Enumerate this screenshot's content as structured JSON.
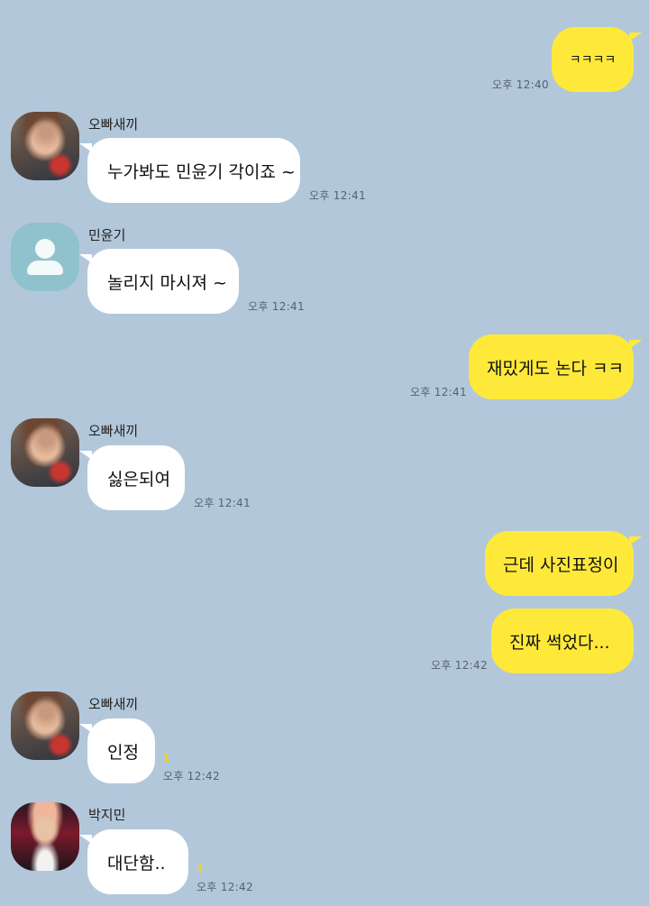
{
  "contacts": {
    "oppa": {
      "name": "오빠새끼",
      "avatar": "photo-avatar"
    },
    "yoongi": {
      "name": "민윤기",
      "avatar": "default-person-icon"
    },
    "jimin": {
      "name": "박지민",
      "avatar": "photo-avatar"
    }
  },
  "messages": [
    {
      "direction": "outgoing",
      "text": "ㅋㅋㅋㅋ",
      "time": "오후 12:40"
    },
    {
      "direction": "incoming",
      "sender": "오빠새끼",
      "text": "누가봐도 민윤기 각이죠 ~",
      "time": "오후 12:41"
    },
    {
      "direction": "incoming",
      "sender": "민윤기",
      "text": "놀리지 마시져 ~",
      "time": "오후 12:41"
    },
    {
      "direction": "outgoing",
      "text": "재밌게도 논다 ㅋㅋ",
      "time": "오후 12:41"
    },
    {
      "direction": "incoming",
      "sender": "오빠새끼",
      "text": "싫은되여",
      "time": "오후 12:41"
    },
    {
      "direction": "outgoing",
      "text": "근데 사진표정이",
      "time": ""
    },
    {
      "direction": "outgoing",
      "text": "진짜 썩었다...",
      "time": "오후 12:42"
    },
    {
      "direction": "incoming",
      "sender": "오빠새끼",
      "text": "인정",
      "time": "오후 12:42",
      "unread": "1"
    },
    {
      "direction": "incoming",
      "sender": "박지민",
      "text": "대단함..",
      "time": "오후 12:42",
      "unread": "1"
    }
  ],
  "colors": {
    "background": "#b2c7da",
    "outgoing_bubble": "#fee93a",
    "incoming_bubble": "#ffffff",
    "unread": "#f2d21b"
  }
}
